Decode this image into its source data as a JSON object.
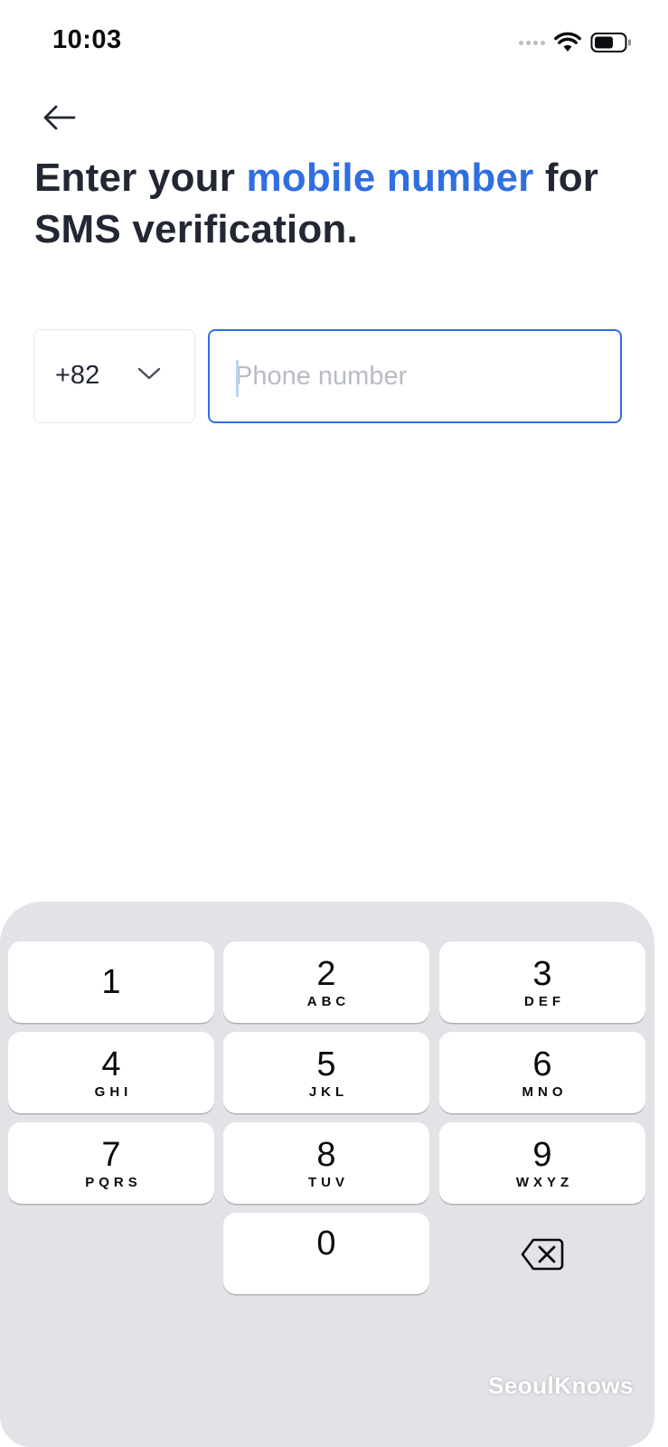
{
  "status_bar": {
    "time": "10:03"
  },
  "title": {
    "prefix": "Enter your ",
    "accent": "mobile number",
    "suffix": " for SMS verification."
  },
  "phone": {
    "country_code": "+82",
    "value": "",
    "placeholder": "Phone number"
  },
  "keypad": {
    "keys": [
      {
        "digit": "1",
        "letters": ""
      },
      {
        "digit": "2",
        "letters": "ABC"
      },
      {
        "digit": "3",
        "letters": "DEF"
      },
      {
        "digit": "4",
        "letters": "GHI"
      },
      {
        "digit": "5",
        "letters": "JKL"
      },
      {
        "digit": "6",
        "letters": "MNO"
      },
      {
        "digit": "7",
        "letters": "PQRS"
      },
      {
        "digit": "8",
        "letters": "TUV"
      },
      {
        "digit": "9",
        "letters": "WXYZ"
      },
      {
        "digit": "0",
        "letters": ""
      }
    ],
    "delete_icon": "backspace-icon"
  },
  "watermark": "SeoulKnows",
  "colors": {
    "accent": "#2f6fe0",
    "text": "#222733",
    "placeholder": "#b8bcc4",
    "keypad_bg": "#e2e3e7"
  }
}
